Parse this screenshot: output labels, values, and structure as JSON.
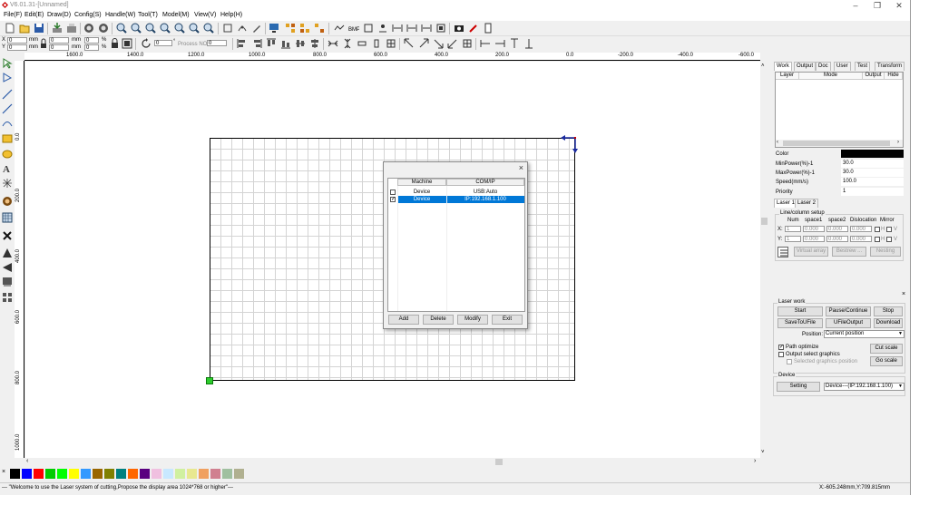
{
  "window": {
    "title": "V6.01.31-[Unnamed]"
  },
  "menu": [
    "File(F)",
    "Edit(E)",
    "Draw(D)",
    "Config(S)",
    "Handle(W)",
    "Tool(T)",
    "Model(M)",
    "View(V)",
    "Help(H)"
  ],
  "toolbar2": {
    "x_value": "0",
    "x_unit": "mm",
    "y_value": "0",
    "y_unit": "mm",
    "w_value": "0",
    "w_unit": "mm",
    "h_value": "0",
    "h_unit": "mm",
    "pw_value": "0",
    "pw_unit": "%",
    "ph_value": "0",
    "ph_unit": "%",
    "rx_label": "X",
    "ry_label": "Y",
    "angle_value": "0",
    "angle_unit": "°",
    "process_no_label": "Process NO:",
    "process_no_value": "0"
  },
  "ruler_h": [
    "1600.0",
    "1400.0",
    "1200.0",
    "1000.0",
    "800.0",
    "600.0",
    "400.0",
    "200.0",
    "0.0",
    "-200.0",
    "-400.0",
    "-600.0"
  ],
  "ruler_v": [
    "0.0",
    "200.0",
    "400.0",
    "600.0",
    "800.0",
    "1000.0"
  ],
  "dialog": {
    "close": "×",
    "columns": [
      "Machine",
      "COM/IP"
    ],
    "rows": [
      {
        "checked": false,
        "machine": "Device",
        "com": "USB:Auto"
      },
      {
        "checked": true,
        "machine": "Device",
        "com": "IP:192.168.1.100"
      }
    ],
    "buttons": {
      "add": "Add",
      "delete": "Delete",
      "modify": "Modify",
      "exit": "Exit"
    }
  },
  "right_panel": {
    "tabs": [
      "Work",
      "Output",
      "Doc",
      "User",
      "Test",
      "Transform"
    ],
    "layer_columns": [
      "Layer",
      "Mode",
      "Output",
      "Hide"
    ],
    "props": [
      {
        "label": "Color",
        "value": ""
      },
      {
        "label": "MinPower(%)-1",
        "value": "30.0"
      },
      {
        "label": "MaxPower(%)-1",
        "value": "30.0"
      },
      {
        "label": "Speed(mm/s)",
        "value": "100.0"
      },
      {
        "label": "Priority",
        "value": "1"
      }
    ],
    "color_swatch": "#000000",
    "laser_tabs": [
      "Laser 1",
      "Laser 2"
    ],
    "line_col": {
      "title": "Line/column setup",
      "headers": [
        "Num",
        "space1",
        "space2",
        "Dislocation",
        "Mirror"
      ],
      "x_label": "X:",
      "y_label": "Y:",
      "x_num": "1",
      "x_s1": "0.000",
      "x_s2": "0.000",
      "x_dis": "0.000",
      "y_num": "1",
      "y_s1": "0.000",
      "y_s2": "0.000",
      "y_dis": "0.000",
      "h_label": "H",
      "v_label": "V",
      "virtual_array": "Virtual array",
      "best_row": "Bestrew ...",
      "nesting": "Nesting"
    },
    "laser_work": {
      "title": "Laser work",
      "start": "Start",
      "pause": "Pause/Continue",
      "stop": "Stop",
      "save_to_ufile": "SaveToUFile",
      "ufile_output": "UFileOutput",
      "download": "Download",
      "position_label": "Position:",
      "position_value": "Current position",
      "path_optimize": "Path optimize",
      "output_select": "Output select graphics",
      "selected_position": "Selected graphics position",
      "cut_scale": "Cut scale",
      "go_scale": "Go scale"
    },
    "device": {
      "title": "Device",
      "setting": "Setting",
      "value": "Device---(IP:192.168.1.100)"
    }
  },
  "palette": [
    "#000000",
    "#0000ff",
    "#ff0000",
    "#00cc00",
    "#00ff00",
    "#ffff00",
    "#3399ff",
    "#996600",
    "#808000",
    "#008080",
    "#ff6600",
    "#5a0080",
    "#f0c0e0",
    "#c8e8ff",
    "#d0f0a0",
    "#e8e890",
    "#f0a060",
    "#d08090",
    "#a0c0a0",
    "#b0b090"
  ],
  "status": {
    "message": "--- \"Welcome to use the Laser system of cutting,Propose the display area 1024*768 or higher\"---",
    "coords": "X:-605.248mm,Y:709.815mm"
  }
}
